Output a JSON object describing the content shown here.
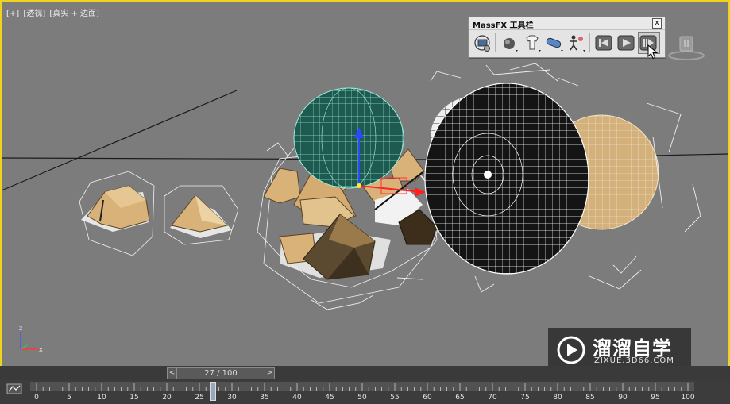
{
  "viewport": {
    "label_parts": [
      "[+]",
      "[透视]",
      "[真实 + 边面]"
    ]
  },
  "massfx_toolbar": {
    "title": "MassFX 工具栏",
    "close_label": "x",
    "buttons": [
      {
        "name": "world-settings-button",
        "icon": "globe-gear-icon"
      },
      {
        "name": "rigid-body-button",
        "icon": "sphere-icon"
      },
      {
        "name": "mcloth-button",
        "icon": "shirt-icon"
      },
      {
        "name": "constraint-button",
        "icon": "capsule-icon"
      },
      {
        "name": "ragdoll-button",
        "icon": "ragdoll-icon"
      },
      {
        "name": "reset-simulation-button",
        "icon": "rewind-icon"
      },
      {
        "name": "play-simulation-button",
        "icon": "play-icon"
      },
      {
        "name": "step-simulation-button",
        "icon": "step-icon"
      }
    ]
  },
  "time_slider": {
    "prev_label": "<",
    "frame_display": "27 / 100",
    "next_label": ">",
    "current_frame": 27,
    "total_frames": 100
  },
  "track_bar": {
    "ticks": [
      "0",
      "5",
      "10",
      "15",
      "20",
      "25",
      "30",
      "35",
      "40",
      "45",
      "50",
      "55",
      "60",
      "65",
      "70",
      "75",
      "80",
      "85",
      "90",
      "95",
      "100"
    ]
  },
  "watermark": {
    "title": "溜溜自学",
    "subtitle": "ZIXUE.3D66.COM"
  },
  "axis_labels": {
    "z": "z",
    "x": "x"
  },
  "colors": {
    "viewport_bg": "#7c7c7c",
    "viewport_border": "#f0d31c",
    "rock_face": "#d9b27a",
    "sphere_green": "#1f5a50",
    "sphere_black": "#141414",
    "sphere_tan": "#d4b07a"
  }
}
